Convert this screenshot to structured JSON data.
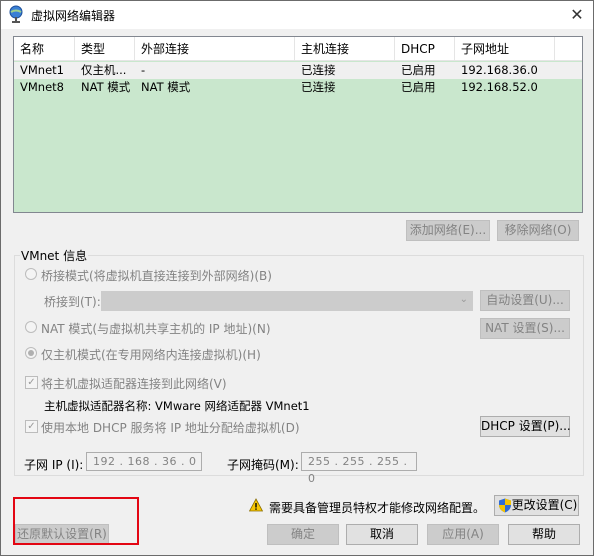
{
  "window": {
    "title": "虚拟网络编辑器",
    "close": "✕"
  },
  "table": {
    "headers": [
      "名称",
      "类型",
      "外部连接",
      "主机连接",
      "DHCP",
      "子网地址"
    ],
    "rows": [
      {
        "name": "VMnet1",
        "type": "仅主机...",
        "external": "-",
        "host": "已连接",
        "dhcp": "已启用",
        "subnet": "192.168.36.0"
      },
      {
        "name": "VMnet8",
        "type": "NAT 模式",
        "external": "NAT 模式",
        "host": "已连接",
        "dhcp": "已启用",
        "subnet": "192.168.52.0"
      }
    ]
  },
  "buttons": {
    "add_network": "添加网络(E)...",
    "remove_network": "移除网络(O)",
    "auto_settings": "自动设置(U)...",
    "nat_settings": "NAT 设置(S)...",
    "dhcp_settings": "DHCP 设置(P)...",
    "change_settings": "更改设置(C)",
    "restore_defaults": "还原默认设置(R)",
    "ok": "确定",
    "cancel": "取消",
    "apply": "应用(A)",
    "help": "帮助"
  },
  "vmnet_info": {
    "title": "VMnet 信息",
    "bridged": "桥接模式(将虚拟机直接连接到外部网络)(B)",
    "bridged_to": "桥接到(T):",
    "nat": "NAT 模式(与虚拟机共享主机的 IP 地址)(N)",
    "host_only": "仅主机模式(在专用网络内连接虚拟机)(H)",
    "connect_adapter": "将主机虚拟适配器连接到此网络(V)",
    "adapter_name": "主机虚拟适配器名称: VMware 网络适配器 VMnet1",
    "use_dhcp": "使用本地 DHCP 服务将 IP 地址分配给虚拟机(D)",
    "subnet_ip_label": "子网 IP (I):",
    "subnet_ip": "192 . 168 . 36 . 0",
    "subnet_mask_label": "子网掩码(M):",
    "subnet_mask": "255 . 255 . 255 . 0"
  },
  "notice": "需要具备管理员特权才能修改网络配置。",
  "colors": {
    "table_bg": "#c9e7cd",
    "highlight": "#e30613"
  }
}
